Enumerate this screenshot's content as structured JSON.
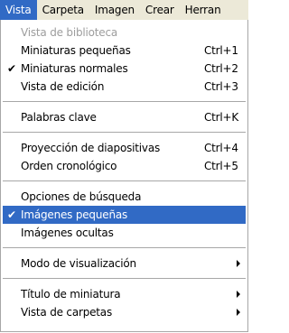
{
  "menubar": {
    "items": [
      {
        "label": "Vista",
        "active": true
      },
      {
        "label": "Carpeta"
      },
      {
        "label": "Imagen"
      },
      {
        "label": "Crear"
      },
      {
        "label": "Herran"
      }
    ]
  },
  "menu": {
    "items": [
      {
        "label": "Vista de biblioteca",
        "disabled": true
      },
      {
        "label": "Miniaturas pequeñas",
        "shortcut": "Ctrl+1"
      },
      {
        "label": "Miniaturas normales",
        "shortcut": "Ctrl+2",
        "checked": true
      },
      {
        "label": "Vista de edición",
        "shortcut": "Ctrl+3"
      },
      {
        "label": "Palabras clave",
        "shortcut": "Ctrl+K"
      },
      {
        "label": "Proyección de diapositivas",
        "shortcut": "Ctrl+4"
      },
      {
        "label": "Orden cronológico",
        "shortcut": "Ctrl+5"
      },
      {
        "label": "Opciones de búsqueda"
      },
      {
        "label": "Imágenes pequeñas",
        "checked": true,
        "highlighted": true
      },
      {
        "label": "Imágenes ocultas"
      },
      {
        "label": "Modo de visualización",
        "submenu": true
      },
      {
        "label": "Título de miniatura",
        "submenu": true
      },
      {
        "label": "Vista de carpetas",
        "submenu": true
      }
    ],
    "check_glyph": "✔"
  },
  "colors": {
    "highlight": "#316ac5",
    "disabled_text": "#9d9d9d",
    "menubar_bg": "#ece9d8"
  }
}
